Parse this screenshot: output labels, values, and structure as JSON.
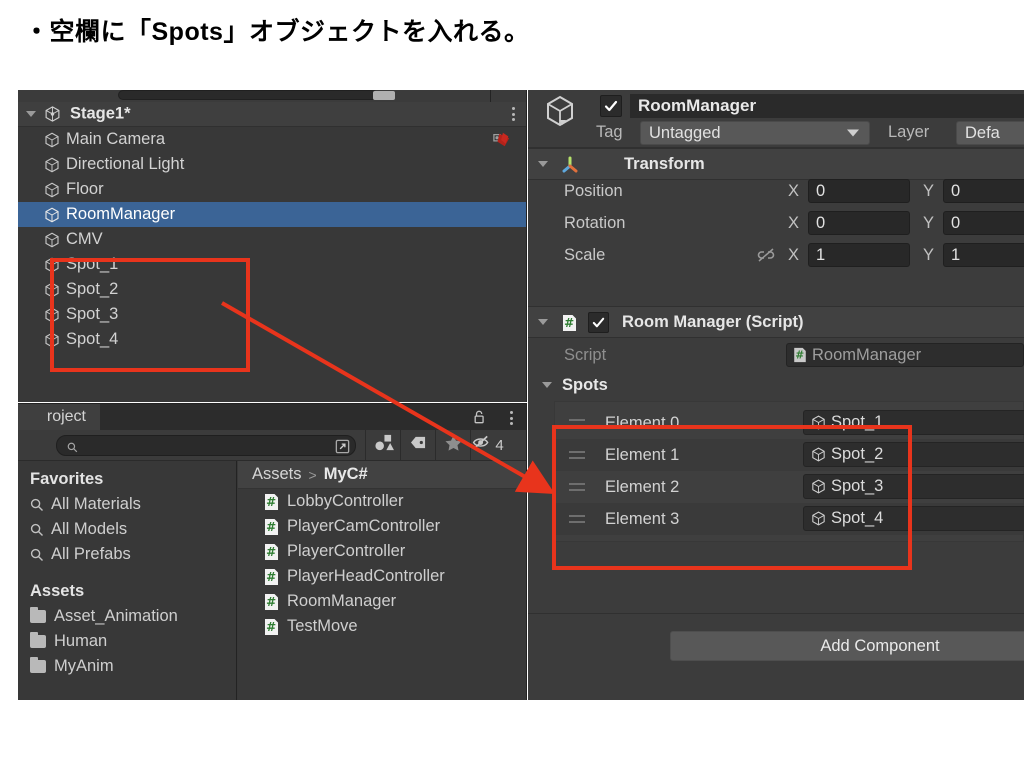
{
  "caption": "・空欄に「Spots」オブジェクトを入れる。",
  "colors": {
    "annotation_red": "#e8341c",
    "selection_blue": "#3b6496",
    "panel_bg": "#383838",
    "inspector_bg": "#3c3c3c",
    "csharp_green": "#2f7d32"
  },
  "hierarchy": {
    "scene_name": "Stage1*",
    "scene_icon": "unity-logo-icon",
    "menu_icon": "kebab-menu-icon",
    "items": [
      {
        "label": "Main Camera",
        "icon": "gameobject-cube-icon",
        "selected": false,
        "badge": "prefab-broken-icon"
      },
      {
        "label": "Directional Light",
        "icon": "gameobject-cube-icon",
        "selected": false,
        "badge": ""
      },
      {
        "label": "Floor",
        "icon": "gameobject-cube-icon",
        "selected": false,
        "badge": ""
      },
      {
        "label": "RoomManager",
        "icon": "gameobject-cube-icon",
        "selected": true,
        "badge": ""
      },
      {
        "label": "CMV",
        "icon": "gameobject-cube-icon",
        "selected": false,
        "badge": ""
      },
      {
        "label": "Spot_1",
        "icon": "gameobject-cube-icon",
        "selected": false,
        "badge": ""
      },
      {
        "label": "Spot_2",
        "icon": "gameobject-cube-icon",
        "selected": false,
        "badge": ""
      },
      {
        "label": "Spot_3",
        "icon": "gameobject-cube-icon",
        "selected": false,
        "badge": ""
      },
      {
        "label": "Spot_4",
        "icon": "gameobject-cube-icon",
        "selected": false,
        "badge": ""
      }
    ]
  },
  "project": {
    "tab_label": "roject",
    "lock_icon": "lock-open-icon",
    "menu_icon": "kebab-menu-icon",
    "search": {
      "value": "",
      "placeholder": "",
      "icon": "search-icon",
      "expand_icon": "open-in-new-icon"
    },
    "toolbar_buttons": [
      {
        "icon": "shapes-filter-icon",
        "label": ""
      },
      {
        "icon": "tag-filter-icon",
        "label": ""
      },
      {
        "icon": "star-favorite-icon",
        "label": ""
      },
      {
        "icon": "eye-hidden-icon",
        "label": "4"
      }
    ],
    "favorites_header": "Favorites",
    "favorites": [
      {
        "label": "All Materials",
        "icon": "search-icon"
      },
      {
        "label": "All Models",
        "icon": "search-icon"
      },
      {
        "label": "All Prefabs",
        "icon": "search-icon"
      }
    ],
    "assets_header": "Assets",
    "folders": [
      {
        "label": "Asset_Animation",
        "icon": "folder-icon"
      },
      {
        "label": "Human",
        "icon": "folder-icon"
      },
      {
        "label": "MyAnim",
        "icon": "folder-icon"
      }
    ],
    "breadcrumb": {
      "root": "Assets",
      "separator": ">",
      "current": "MyC#"
    },
    "files": [
      {
        "label": "LobbyController",
        "icon": "csharp-script-icon"
      },
      {
        "label": "PlayerCamController",
        "icon": "csharp-script-icon"
      },
      {
        "label": "PlayerController",
        "icon": "csharp-script-icon"
      },
      {
        "label": "PlayerHeadController",
        "icon": "csharp-script-icon"
      },
      {
        "label": "RoomManager",
        "icon": "csharp-script-icon"
      },
      {
        "label": "TestMove",
        "icon": "csharp-script-icon"
      }
    ]
  },
  "inspector": {
    "gameobject": {
      "icon": "gameobject-cube-icon",
      "enabled_checkbox": "checkbox-checked-icon",
      "name": "RoomManager",
      "tag_label": "Tag",
      "tag_value": "Untagged",
      "layer_label": "Layer",
      "layer_value": "Defa"
    },
    "transform": {
      "title": "Transform",
      "icon": "transform-axis-icon",
      "rows": [
        {
          "label": "Position",
          "x_axis": "X",
          "x": "0",
          "y_axis": "Y",
          "y": "0",
          "link_icon": ""
        },
        {
          "label": "Rotation",
          "x_axis": "X",
          "x": "0",
          "y_axis": "Y",
          "y": "0",
          "link_icon": ""
        },
        {
          "label": "Scale",
          "x_axis": "X",
          "x": "1",
          "y_axis": "Y",
          "y": "1",
          "link_icon": "link-broken-icon"
        }
      ]
    },
    "room_manager": {
      "title": "Room Manager (Script)",
      "icon": "csharp-script-icon",
      "enabled_checkbox": "checkbox-checked-icon",
      "script_label": "Script",
      "script_value": "RoomManager",
      "script_value_icon": "csharp-script-icon",
      "spots_label": "Spots",
      "elements": [
        {
          "label": "Element 0",
          "value": "Spot_1",
          "icon": "gameobject-cube-icon",
          "grip": "drag-handle-icon"
        },
        {
          "label": "Element 1",
          "value": "Spot_2",
          "icon": "gameobject-cube-icon",
          "grip": "drag-handle-icon"
        },
        {
          "label": "Element 2",
          "value": "Spot_3",
          "icon": "gameobject-cube-icon",
          "grip": "drag-handle-icon"
        },
        {
          "label": "Element 3",
          "value": "Spot_4",
          "icon": "gameobject-cube-icon",
          "grip": "drag-handle-icon"
        }
      ]
    },
    "add_component_label": "Add Component"
  }
}
